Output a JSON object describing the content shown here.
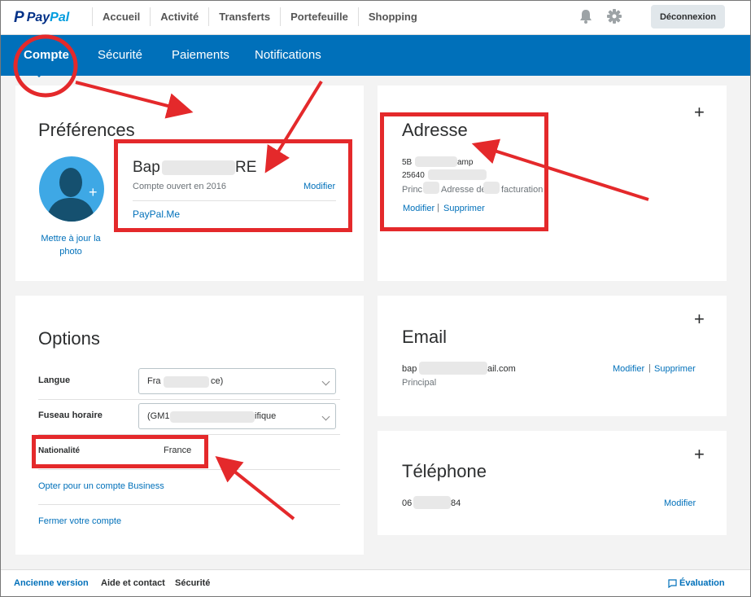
{
  "brand": {
    "p": "P",
    "word1": "Pay",
    "word2": "Pal"
  },
  "topnav": [
    "Accueil",
    "Activité",
    "Transferts",
    "Portefeuille",
    "Shopping"
  ],
  "logout_label": "Déconnexion",
  "subnav": [
    "Compte",
    "Sécurité",
    "Paiements",
    "Notifications"
  ],
  "preferences": {
    "title": "Préférences",
    "update_photo_line1": "Mettre à jour la",
    "update_photo_line2": "photo",
    "name_start": "Bap",
    "name_end": "RE",
    "account_opened": "Compte ouvert en 2016",
    "modify": "Modifier",
    "paypal_me": "PayPal.Me"
  },
  "address": {
    "title": "Adresse",
    "line1_start": "5B",
    "line1_end": "amp",
    "line2_start": "25640",
    "line3_start": "Princ",
    "line3_mid": "Adresse de",
    "line3_end": "facturation",
    "modify": "Modifier",
    "delete": "Supprimer"
  },
  "options": {
    "title": "Options",
    "language_label": "Langue",
    "language_start": "Fra",
    "language_end": "ce)",
    "timezone_label": "Fuseau horaire",
    "timezone_start": "(GM1",
    "timezone_end": "ifique",
    "nationality_label": "Nationalité",
    "nationality_value": "France",
    "business_link": "Opter pour un compte Business",
    "close_link": "Fermer votre compte"
  },
  "email": {
    "title": "Email",
    "value_start": "bap",
    "value_end": "ail.com",
    "primary": "Principal",
    "modify": "Modifier",
    "delete": "Supprimer"
  },
  "phone": {
    "title": "Téléphone",
    "value_start": "06",
    "value_end": "84",
    "modify": "Modifier"
  },
  "plus": "+",
  "separator": "|",
  "footer": {
    "old_version": "Ancienne version",
    "help": "Aide et contact",
    "security": "Sécurité",
    "feedback": "Évaluation"
  },
  "colors": {
    "brand_blue": "#0070ba",
    "annotation_red": "#e4292b"
  },
  "icons": [
    "bell-icon",
    "gear-icon",
    "avatar-icon",
    "add-photo-icon",
    "chevron-down-icon",
    "feedback-icon"
  ]
}
